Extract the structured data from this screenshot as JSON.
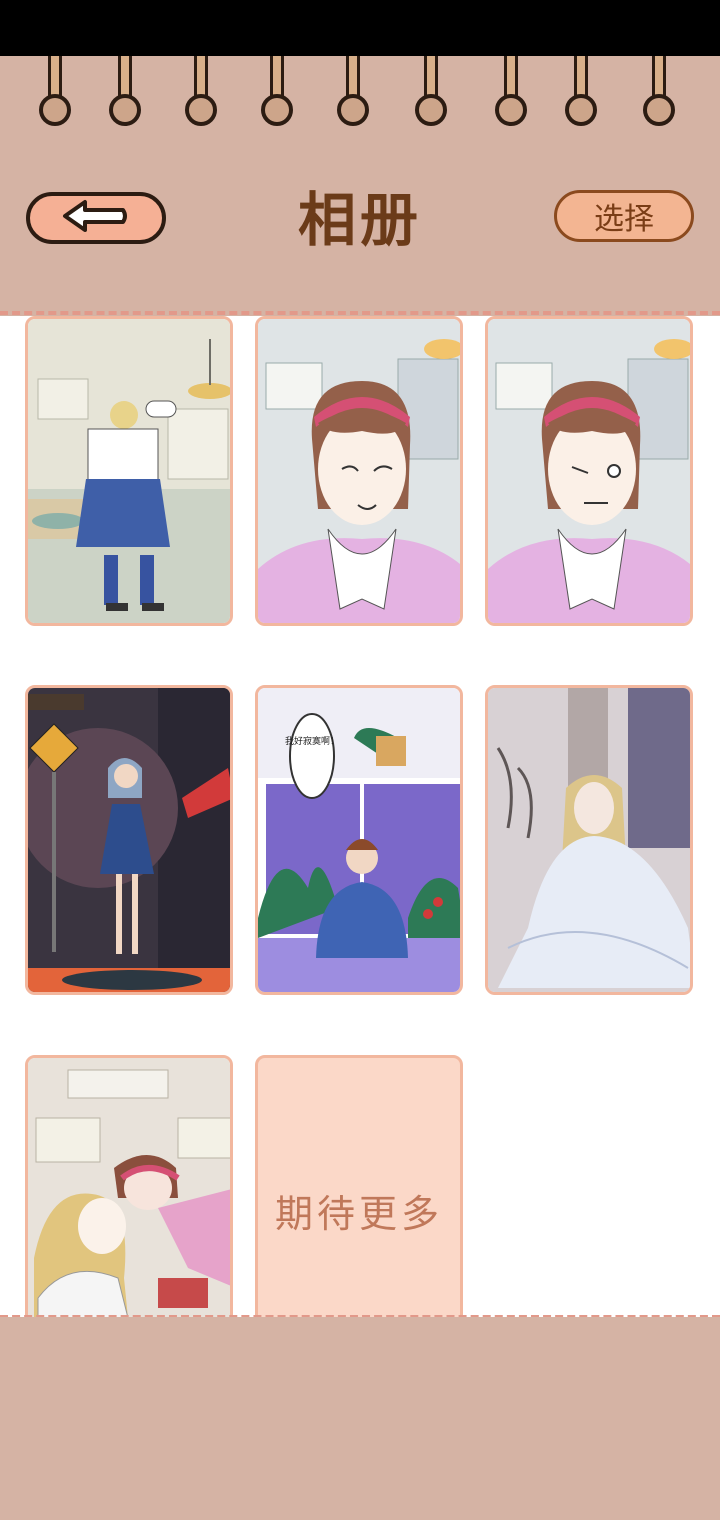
{
  "header": {
    "title": "相册",
    "back_icon": "arrow-left-icon",
    "select_label": "选择"
  },
  "album": {
    "photos": [
      {
        "name": "photo-1",
        "scene": "girl-sailor-uniform-back"
      },
      {
        "name": "photo-2",
        "scene": "girl-headband-smile"
      },
      {
        "name": "photo-3",
        "scene": "girl-headband-grimace"
      },
      {
        "name": "photo-4",
        "scene": "girl-blue-dress-street"
      },
      {
        "name": "photo-5",
        "scene": "boy-at-window",
        "speech": "我好寂寞啊！"
      },
      {
        "name": "photo-6",
        "scene": "elf-in-white-robe"
      },
      {
        "name": "photo-7",
        "scene": "two-girls-hug"
      }
    ],
    "more_label": "期待更多"
  },
  "colors": {
    "header_bg": "#d5b3a4",
    "accent": "#f5b095",
    "title": "#6b3b19",
    "card_border": "#f2b79e"
  }
}
